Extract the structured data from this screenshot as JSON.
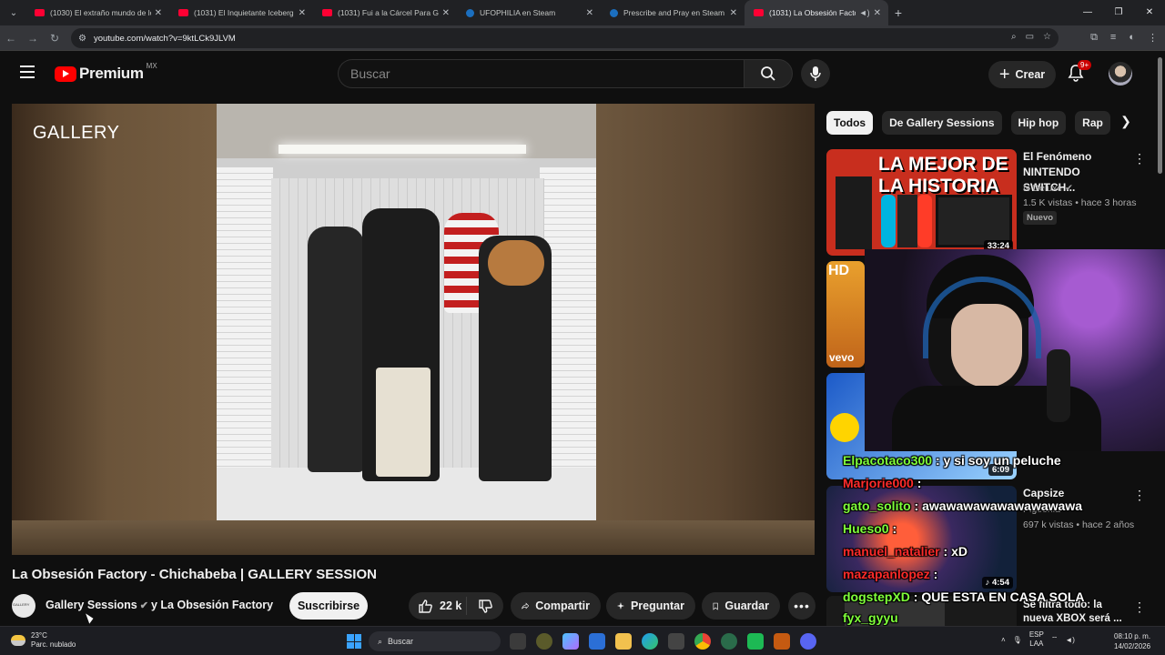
{
  "browser": {
    "tabs": [
      {
        "title": "(1030) El extraño mundo de los",
        "favicon": "youtube-icon",
        "active": false
      },
      {
        "title": "(1031) El Inquietante Iceberg de",
        "favicon": "youtube-icon",
        "active": false
      },
      {
        "title": "(1031) Fui a la Cárcel Para Gord",
        "favicon": "youtube-icon",
        "active": false
      },
      {
        "title": "UFOPHILIA en Steam",
        "favicon": "steam-icon",
        "active": false
      },
      {
        "title": "Prescribe and Pray en Steam",
        "favicon": "steam-icon",
        "active": false
      },
      {
        "title": "(1031) La Obsesión Factory",
        "favicon": "youtube-icon",
        "active": true
      }
    ],
    "url": "youtube.com/watch?v=9ktLCk9JLVM"
  },
  "header": {
    "logo_text": "Premium",
    "country_code": "MX",
    "search_placeholder": "Buscar",
    "create_label": "Crear",
    "notification_count": "9+"
  },
  "video": {
    "overlay_text": "GALLERY",
    "title": "La Obsesión Factory - Chichabeba | GALLERY SESSION",
    "channel": "Gallery Sessions",
    "collab": "y La Obsesión Factory",
    "subscribe_label": "Suscribirse",
    "likes": "22 k",
    "share_label": "Compartir",
    "ask_label": "Preguntar",
    "save_label": "Guardar"
  },
  "chips": [
    "Todos",
    "De Gallery Sessions",
    "Hip hop",
    "Rap"
  ],
  "recommendations": [
    {
      "title": "El Fenómeno NINTENDO SWITCH...",
      "channel": "N Deluxe",
      "stats": "1.5 K vistas • hace 3 horas",
      "badge": "Nuevo",
      "duration": "33:24",
      "thumb_text": "LA MEJOR DE LA HISTORIA"
    },
    {
      "title": "",
      "thumb_text": "HD",
      "watermark": "vevo"
    },
    {
      "title": "",
      "duration": "6:09"
    },
    {
      "title": "Capsize",
      "channel": "Pigeonia",
      "stats": "697 k vistas • hace 2 años",
      "duration": "4:54"
    },
    {
      "title": "Se filtra todo: la nueva XBOX será ..."
    }
  ],
  "chat": [
    {
      "user": "Elpacotaco300",
      "message": "y si soy un peluche",
      "color": "#7fff3a"
    },
    {
      "user": "Marjorie000",
      "message": "",
      "color": "#ff2b2b"
    },
    {
      "user": "gato_solito",
      "message": "awawawawawawawawawa",
      "color": "#7fff3a"
    },
    {
      "user": "Hueso0",
      "message": "",
      "color": "#7fff3a"
    },
    {
      "user": "manuel_natalier",
      "message": "xD",
      "color": "#ff2b2b"
    },
    {
      "user": "mazapanlopez",
      "message": "",
      "color": "#ff2b2b"
    },
    {
      "user": "dogstepXD",
      "message": "QUE ESTA EN CASA SOLA",
      "color": "#7fff3a"
    },
    {
      "user": "fyx_gyyu",
      "message": "",
      "color": "#7fff3a"
    }
  ],
  "taskbar": {
    "temperature": "23°C",
    "weather": "Parc. nublado",
    "search_label": "Buscar",
    "lang1": "ESP",
    "lang2": "LAA",
    "time": "08:10 p. m.",
    "date": "14/02/2026"
  },
  "colors": {
    "accent": "#ff0000",
    "background": "#0f0f0f",
    "chip_selected": "#f1f1f1"
  }
}
